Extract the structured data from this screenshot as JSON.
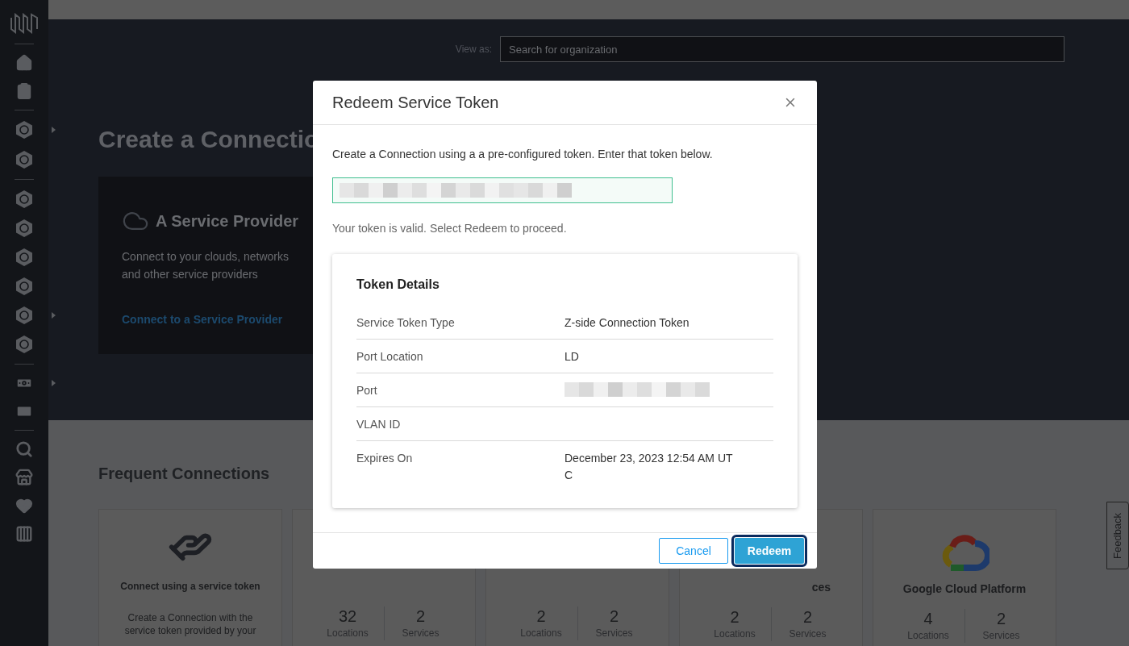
{
  "org_search": {
    "label": "View as:",
    "placeholder": "Search for organization"
  },
  "hero": {
    "title": "Create a Connectio",
    "provider_card": {
      "title": "A Service Provider",
      "description": "Connect to your clouds, networks and other service providers",
      "link": "Connect to a Service Provider"
    }
  },
  "frequent": {
    "title": "Frequent Connections",
    "cards": [
      {
        "kind": "token",
        "title": "Connect using a service token",
        "description": "Create a Connection with the service token provided by your"
      },
      {
        "kind": "stats",
        "stats": [
          {
            "value": "32",
            "label": "Locations"
          },
          {
            "value": "2",
            "label": "Services"
          }
        ]
      },
      {
        "kind": "stats",
        "stats": [
          {
            "value": "2",
            "label": "Locations"
          },
          {
            "value": "2",
            "label": "Services"
          }
        ]
      },
      {
        "kind": "stats",
        "title": "ces",
        "stats": [
          {
            "value": "2",
            "label": "Locations"
          },
          {
            "value": "2",
            "label": "Services"
          }
        ]
      },
      {
        "kind": "gcp",
        "title": "Google Cloud Platform",
        "stats": [
          {
            "value": "4",
            "label": "Locations"
          },
          {
            "value": "2",
            "label": "Services"
          }
        ]
      }
    ]
  },
  "feedback_tab": "Feedback",
  "dialog": {
    "title": "Redeem Service Token",
    "intro": "Create a Connection using a a pre-configured token. Enter that token below.",
    "token_field": {
      "redacted": true,
      "valid": true
    },
    "message": "Your token is valid. Select Redeem to proceed.",
    "details": {
      "title": "Token Details",
      "rows": [
        {
          "label": "Service Token Type",
          "value": "Z-side Connection Token"
        },
        {
          "label": "Port Location",
          "value": "LD"
        },
        {
          "label": "Port",
          "redacted": true
        },
        {
          "label": "VLAN ID"
        },
        {
          "label": "Expires On",
          "value": "December 23, 2023 12:54 AM UTC"
        }
      ]
    },
    "buttons": [
      {
        "label": "Cancel",
        "kind": "secondary",
        "focused": false
      },
      {
        "label": "Redeem",
        "kind": "primary",
        "focused": true
      }
    ]
  }
}
